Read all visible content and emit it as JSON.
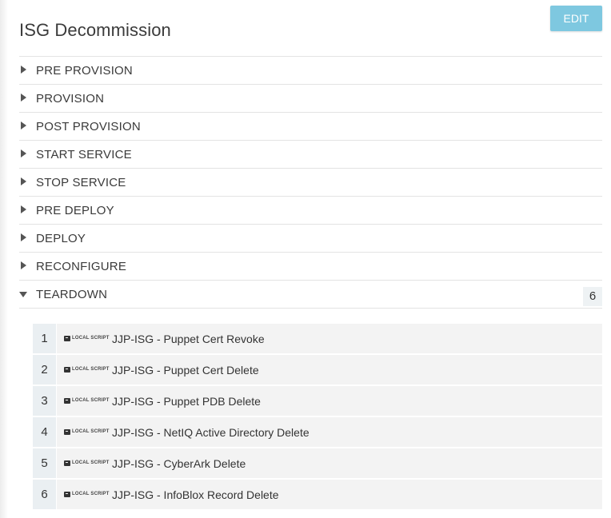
{
  "page": {
    "title": "ISG Decommission",
    "edit_label": "EDIT"
  },
  "sections": [
    {
      "label": "PRE PROVISION",
      "expanded": false
    },
    {
      "label": "PROVISION",
      "expanded": false
    },
    {
      "label": "POST PROVISION",
      "expanded": false
    },
    {
      "label": "START SERVICE",
      "expanded": false
    },
    {
      "label": "STOP SERVICE",
      "expanded": false
    },
    {
      "label": "PRE DEPLOY",
      "expanded": false
    },
    {
      "label": "DEPLOY",
      "expanded": false
    },
    {
      "label": "RECONFIGURE",
      "expanded": false
    },
    {
      "label": "TEARDOWN",
      "expanded": true,
      "count": "6"
    }
  ],
  "teardown_steps": [
    {
      "num": "1",
      "type": "LOCAL SCRIPT",
      "name": "JJP-ISG - Puppet Cert Revoke"
    },
    {
      "num": "2",
      "type": "LOCAL SCRIPT",
      "name": "JJP-ISG - Puppet Cert Delete"
    },
    {
      "num": "3",
      "type": "LOCAL SCRIPT",
      "name": "JJP-ISG - Puppet PDB Delete"
    },
    {
      "num": "4",
      "type": "LOCAL SCRIPT",
      "name": "JJP-ISG - NetIQ Active Directory Delete"
    },
    {
      "num": "5",
      "type": "LOCAL SCRIPT",
      "name": "JJP-ISG - CyberArk Delete"
    },
    {
      "num": "6",
      "type": "LOCAL SCRIPT",
      "name": "JJP-ISG - InfoBlox Record Delete"
    }
  ],
  "icons": {
    "collapsed": "caret-right-icon",
    "expanded": "caret-down-icon",
    "step": "terminal-icon"
  },
  "colors": {
    "edit_button": "#7ec8e0",
    "divider": "#e3e3e3",
    "step_background": "#f3f3f3",
    "step_number_background": "#eaeff2"
  }
}
